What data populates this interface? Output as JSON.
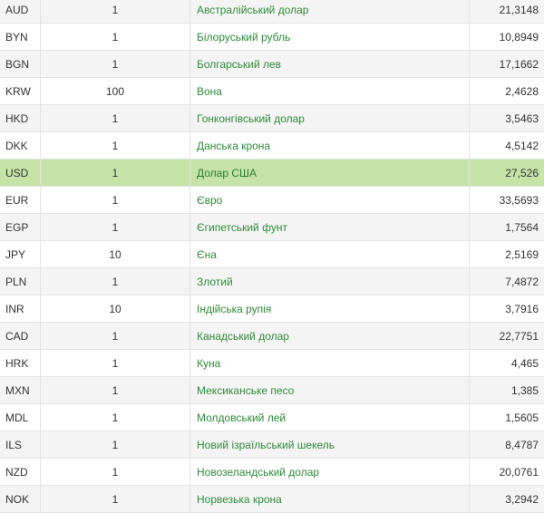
{
  "rates": [
    {
      "code": "AUD",
      "units": "1",
      "name": "Австралійський долар",
      "rate": "21,3148"
    },
    {
      "code": "BYN",
      "units": "1",
      "name": "Білоруський рубль",
      "rate": "10,8949"
    },
    {
      "code": "BGN",
      "units": "1",
      "name": "Болгарський лев",
      "rate": "17,1662"
    },
    {
      "code": "KRW",
      "units": "100",
      "name": "Вона",
      "rate": "2,4628"
    },
    {
      "code": "HKD",
      "units": "1",
      "name": "Гонконгівський долар",
      "rate": "3,5463"
    },
    {
      "code": "DKK",
      "units": "1",
      "name": "Данська крона",
      "rate": "4,5142"
    },
    {
      "code": "USD",
      "units": "1",
      "name": "Долар США",
      "rate": "27,526"
    },
    {
      "code": "EUR",
      "units": "1",
      "name": "Євро",
      "rate": "33,5693"
    },
    {
      "code": "EGP",
      "units": "1",
      "name": "Єгипетський фунт",
      "rate": "1,7564"
    },
    {
      "code": "JPY",
      "units": "10",
      "name": "Єна",
      "rate": "2,5169"
    },
    {
      "code": "PLN",
      "units": "1",
      "name": "Злотий",
      "rate": "7,4872"
    },
    {
      "code": "INR",
      "units": "10",
      "name": "Індійська рупія",
      "rate": "3,7916"
    },
    {
      "code": "CAD",
      "units": "1",
      "name": "Канадський долар",
      "rate": "22,7751"
    },
    {
      "code": "HRK",
      "units": "1",
      "name": "Куна",
      "rate": "4,465"
    },
    {
      "code": "MXN",
      "units": "1",
      "name": "Мексиканське песо",
      "rate": "1,385"
    },
    {
      "code": "MDL",
      "units": "1",
      "name": "Молдовський лей",
      "rate": "1,5605"
    },
    {
      "code": "ILS",
      "units": "1",
      "name": "Новий ізраїльський шекель",
      "rate": "8,4787"
    },
    {
      "code": "NZD",
      "units": "1",
      "name": "Новозеландський долар",
      "rate": "20,0761"
    },
    {
      "code": "NOK",
      "units": "1",
      "name": "Норвезька крона",
      "rate": "3,2942"
    }
  ],
  "highlight_color": "#c6e4a8",
  "link_color": "#2f8a3a"
}
